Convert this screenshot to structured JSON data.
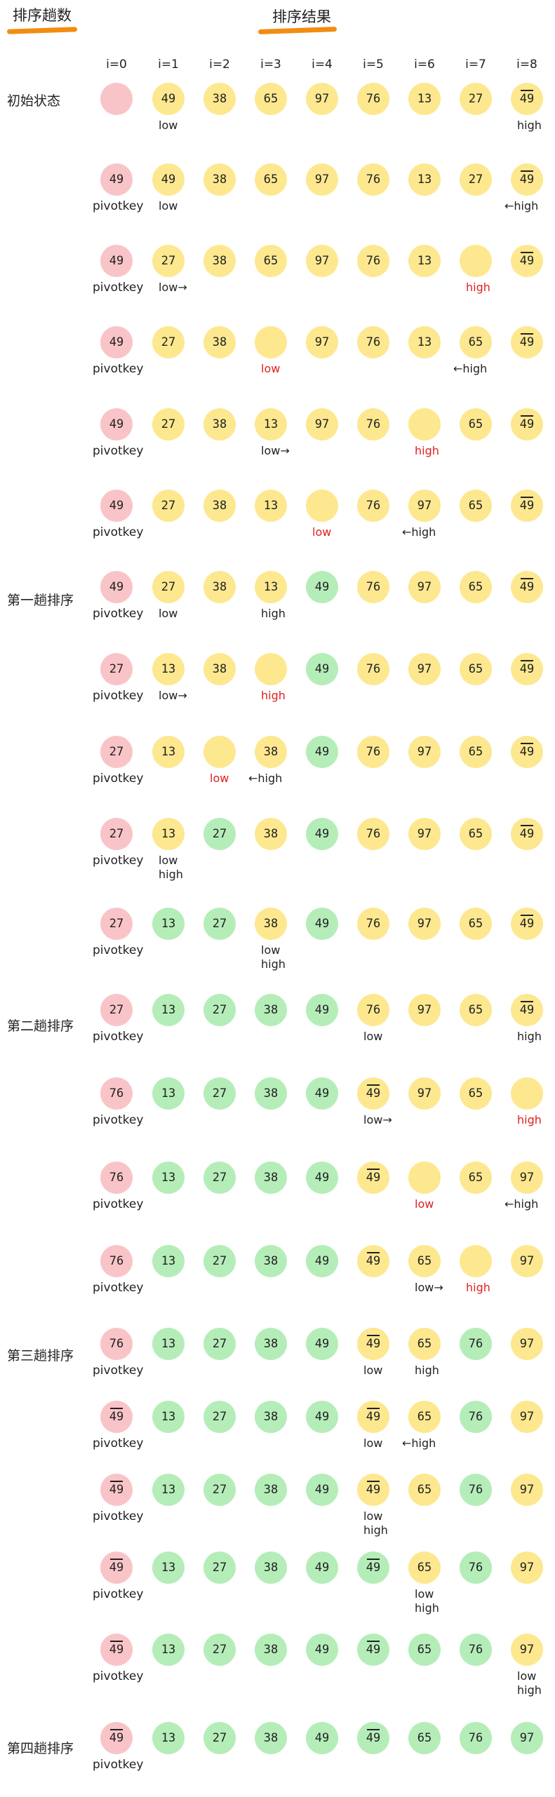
{
  "headers": {
    "left": "排序趟数",
    "right": "排序结果"
  },
  "columns": [
    "i=0",
    "i=1",
    "i=2",
    "i=3",
    "i=4",
    "i=5",
    "i=6",
    "i=7",
    "i=8"
  ],
  "pivot_label": "pivotkey",
  "rows": [
    {
      "label": "初始状态",
      "pivot": false,
      "cells": [
        [
          "",
          "pink"
        ],
        [
          "49",
          "yellow"
        ],
        [
          "38",
          "yellow"
        ],
        [
          "65",
          "yellow"
        ],
        [
          "97",
          "yellow"
        ],
        [
          "76",
          "yellow"
        ],
        [
          "13",
          "yellow"
        ],
        [
          "27",
          "yellow"
        ],
        [
          "49̄",
          "yellow"
        ]
      ],
      "marks": [
        {
          "col": 1,
          "text": "low"
        },
        {
          "col": 8,
          "text": "high"
        }
      ]
    },
    {
      "label": "",
      "pivot": true,
      "cells": [
        [
          "49",
          "pink"
        ],
        [
          "49",
          "yellow"
        ],
        [
          "38",
          "yellow"
        ],
        [
          "65",
          "yellow"
        ],
        [
          "97",
          "yellow"
        ],
        [
          "76",
          "yellow"
        ],
        [
          "13",
          "yellow"
        ],
        [
          "27",
          "yellow"
        ],
        [
          "49̄",
          "yellow"
        ]
      ],
      "marks": [
        {
          "col": 1,
          "text": "low"
        },
        {
          "col": 8,
          "text": "←high"
        }
      ]
    },
    {
      "label": "",
      "pivot": true,
      "cells": [
        [
          "49",
          "pink"
        ],
        [
          "27",
          "yellow"
        ],
        [
          "38",
          "yellow"
        ],
        [
          "65",
          "yellow"
        ],
        [
          "97",
          "yellow"
        ],
        [
          "76",
          "yellow"
        ],
        [
          "13",
          "yellow"
        ],
        [
          "",
          "yellow"
        ],
        [
          "49̄",
          "yellow"
        ]
      ],
      "marks": [
        {
          "col": 1,
          "text": "low→"
        },
        {
          "col": 7,
          "text": "high",
          "red": true
        }
      ]
    },
    {
      "label": "",
      "pivot": true,
      "cells": [
        [
          "49",
          "pink"
        ],
        [
          "27",
          "yellow"
        ],
        [
          "38",
          "yellow"
        ],
        [
          "",
          "yellow"
        ],
        [
          "97",
          "yellow"
        ],
        [
          "76",
          "yellow"
        ],
        [
          "13",
          "yellow"
        ],
        [
          "65",
          "yellow"
        ],
        [
          "49̄",
          "yellow"
        ]
      ],
      "marks": [
        {
          "col": 3,
          "text": "low",
          "red": true
        },
        {
          "col": 7,
          "text": "←high"
        }
      ]
    },
    {
      "label": "",
      "pivot": true,
      "cells": [
        [
          "49",
          "pink"
        ],
        [
          "27",
          "yellow"
        ],
        [
          "38",
          "yellow"
        ],
        [
          "13",
          "yellow"
        ],
        [
          "97",
          "yellow"
        ],
        [
          "76",
          "yellow"
        ],
        [
          "",
          "yellow"
        ],
        [
          "65",
          "yellow"
        ],
        [
          "49̄",
          "yellow"
        ]
      ],
      "marks": [
        {
          "col": 3,
          "text": "low→"
        },
        {
          "col": 6,
          "text": "high",
          "red": true
        }
      ]
    },
    {
      "label": "",
      "pivot": true,
      "cells": [
        [
          "49",
          "pink"
        ],
        [
          "27",
          "yellow"
        ],
        [
          "38",
          "yellow"
        ],
        [
          "13",
          "yellow"
        ],
        [
          "",
          "yellow"
        ],
        [
          "76",
          "yellow"
        ],
        [
          "97",
          "yellow"
        ],
        [
          "65",
          "yellow"
        ],
        [
          "49̄",
          "yellow"
        ]
      ],
      "marks": [
        {
          "col": 4,
          "text": "low",
          "red": true
        },
        {
          "col": 6,
          "text": "←high"
        }
      ]
    },
    {
      "label": "第一趟排序",
      "pivot": true,
      "cells": [
        [
          "49",
          "pink"
        ],
        [
          "27",
          "yellow"
        ],
        [
          "38",
          "yellow"
        ],
        [
          "13",
          "yellow"
        ],
        [
          "49",
          "green"
        ],
        [
          "76",
          "yellow"
        ],
        [
          "97",
          "yellow"
        ],
        [
          "65",
          "yellow"
        ],
        [
          "49̄",
          "yellow"
        ]
      ],
      "marks": [
        {
          "col": 1,
          "text": "low"
        },
        {
          "col": 3,
          "text": "high"
        }
      ]
    },
    {
      "label": "",
      "pivot": true,
      "cells": [
        [
          "27",
          "pink"
        ],
        [
          "13",
          "yellow"
        ],
        [
          "38",
          "yellow"
        ],
        [
          "",
          "yellow"
        ],
        [
          "49",
          "green"
        ],
        [
          "76",
          "yellow"
        ],
        [
          "97",
          "yellow"
        ],
        [
          "65",
          "yellow"
        ],
        [
          "49̄",
          "yellow"
        ]
      ],
      "marks": [
        {
          "col": 1,
          "text": "low→"
        },
        {
          "col": 3,
          "text": "high",
          "red": true
        }
      ]
    },
    {
      "label": "",
      "pivot": true,
      "cells": [
        [
          "27",
          "pink"
        ],
        [
          "13",
          "yellow"
        ],
        [
          "",
          "yellow"
        ],
        [
          "38",
          "yellow"
        ],
        [
          "49",
          "green"
        ],
        [
          "76",
          "yellow"
        ],
        [
          "97",
          "yellow"
        ],
        [
          "65",
          "yellow"
        ],
        [
          "49̄",
          "yellow"
        ]
      ],
      "marks": [
        {
          "col": 2,
          "text": "low",
          "red": true
        },
        {
          "col": 3,
          "text": "←high"
        }
      ]
    },
    {
      "label": "",
      "pivot": true,
      "cells": [
        [
          "27",
          "pink"
        ],
        [
          "13",
          "yellow"
        ],
        [
          "27",
          "green"
        ],
        [
          "38",
          "yellow"
        ],
        [
          "49",
          "green"
        ],
        [
          "76",
          "yellow"
        ],
        [
          "97",
          "yellow"
        ],
        [
          "65",
          "yellow"
        ],
        [
          "49̄",
          "yellow"
        ]
      ],
      "marks": [
        {
          "col": 1,
          "text": "low"
        },
        {
          "col": 1,
          "text": "high",
          "line2": true
        }
      ]
    },
    {
      "label": "",
      "pivot": true,
      "cells": [
        [
          "27",
          "pink"
        ],
        [
          "13",
          "green"
        ],
        [
          "27",
          "green"
        ],
        [
          "38",
          "yellow"
        ],
        [
          "49",
          "green"
        ],
        [
          "76",
          "yellow"
        ],
        [
          "97",
          "yellow"
        ],
        [
          "65",
          "yellow"
        ],
        [
          "49̄",
          "yellow"
        ]
      ],
      "marks": [
        {
          "col": 3,
          "text": "low"
        },
        {
          "col": 3,
          "text": "high",
          "line2": true
        }
      ]
    },
    {
      "label": "第二趟排序",
      "pivot": true,
      "cells": [
        [
          "27",
          "pink"
        ],
        [
          "13",
          "green"
        ],
        [
          "27",
          "green"
        ],
        [
          "38",
          "green"
        ],
        [
          "49",
          "green"
        ],
        [
          "76",
          "yellow"
        ],
        [
          "97",
          "yellow"
        ],
        [
          "65",
          "yellow"
        ],
        [
          "49̄",
          "yellow"
        ]
      ],
      "marks": [
        {
          "col": 5,
          "text": "low"
        },
        {
          "col": 8,
          "text": "high"
        }
      ]
    },
    {
      "label": "",
      "pivot": true,
      "cells": [
        [
          "76",
          "pink"
        ],
        [
          "13",
          "green"
        ],
        [
          "27",
          "green"
        ],
        [
          "38",
          "green"
        ],
        [
          "49",
          "green"
        ],
        [
          "49̄",
          "yellow"
        ],
        [
          "97",
          "yellow"
        ],
        [
          "65",
          "yellow"
        ],
        [
          "",
          "yellow"
        ]
      ],
      "marks": [
        {
          "col": 5,
          "text": "low→"
        },
        {
          "col": 8,
          "text": "high",
          "red": true
        }
      ]
    },
    {
      "label": "",
      "pivot": true,
      "cells": [
        [
          "76",
          "pink"
        ],
        [
          "13",
          "green"
        ],
        [
          "27",
          "green"
        ],
        [
          "38",
          "green"
        ],
        [
          "49",
          "green"
        ],
        [
          "49̄",
          "yellow"
        ],
        [
          "",
          "yellow"
        ],
        [
          "65",
          "yellow"
        ],
        [
          "97",
          "yellow"
        ]
      ],
      "marks": [
        {
          "col": 6,
          "text": "low",
          "red": true
        },
        {
          "col": 8,
          "text": "←high"
        }
      ]
    },
    {
      "label": "",
      "pivot": true,
      "cells": [
        [
          "76",
          "pink"
        ],
        [
          "13",
          "green"
        ],
        [
          "27",
          "green"
        ],
        [
          "38",
          "green"
        ],
        [
          "49",
          "green"
        ],
        [
          "49̄",
          "yellow"
        ],
        [
          "65",
          "yellow"
        ],
        [
          "",
          "yellow"
        ],
        [
          "97",
          "yellow"
        ]
      ],
      "marks": [
        {
          "col": 6,
          "text": "low→"
        },
        {
          "col": 7,
          "text": "high",
          "red": true
        }
      ]
    },
    {
      "label": "第三趟排序",
      "pivot": true,
      "cells": [
        [
          "76",
          "pink"
        ],
        [
          "13",
          "green"
        ],
        [
          "27",
          "green"
        ],
        [
          "38",
          "green"
        ],
        [
          "49",
          "green"
        ],
        [
          "49̄",
          "yellow"
        ],
        [
          "65",
          "yellow"
        ],
        [
          "76",
          "green"
        ],
        [
          "97",
          "yellow"
        ]
      ],
      "marks": [
        {
          "col": 5,
          "text": "low"
        },
        {
          "col": 6,
          "text": "high"
        }
      ]
    },
    {
      "label": "",
      "pivot": true,
      "cells": [
        [
          "49̄",
          "pink"
        ],
        [
          "13",
          "green"
        ],
        [
          "27",
          "green"
        ],
        [
          "38",
          "green"
        ],
        [
          "49",
          "green"
        ],
        [
          "49̄",
          "yellow"
        ],
        [
          "65",
          "yellow"
        ],
        [
          "76",
          "green"
        ],
        [
          "97",
          "yellow"
        ]
      ],
      "marks": [
        {
          "col": 5,
          "text": "low"
        },
        {
          "col": 6,
          "text": "←high"
        }
      ]
    },
    {
      "label": "",
      "pivot": true,
      "cells": [
        [
          "49̄",
          "pink"
        ],
        [
          "13",
          "green"
        ],
        [
          "27",
          "green"
        ],
        [
          "38",
          "green"
        ],
        [
          "49",
          "green"
        ],
        [
          "49̄",
          "yellow"
        ],
        [
          "65",
          "yellow"
        ],
        [
          "76",
          "green"
        ],
        [
          "97",
          "yellow"
        ]
      ],
      "marks": [
        {
          "col": 5,
          "text": "low"
        },
        {
          "col": 5,
          "text": "high",
          "line2": true
        }
      ]
    },
    {
      "label": "",
      "pivot": true,
      "cells": [
        [
          "49̄",
          "pink"
        ],
        [
          "13",
          "green"
        ],
        [
          "27",
          "green"
        ],
        [
          "38",
          "green"
        ],
        [
          "49",
          "green"
        ],
        [
          "49̄",
          "green"
        ],
        [
          "65",
          "yellow"
        ],
        [
          "76",
          "green"
        ],
        [
          "97",
          "yellow"
        ]
      ],
      "marks": [
        {
          "col": 6,
          "text": "low"
        },
        {
          "col": 6,
          "text": "high",
          "line2": true
        }
      ]
    },
    {
      "label": "",
      "pivot": true,
      "cells": [
        [
          "49̄",
          "pink"
        ],
        [
          "13",
          "green"
        ],
        [
          "27",
          "green"
        ],
        [
          "38",
          "green"
        ],
        [
          "49",
          "green"
        ],
        [
          "49̄",
          "green"
        ],
        [
          "65",
          "green"
        ],
        [
          "76",
          "green"
        ],
        [
          "97",
          "yellow"
        ]
      ],
      "marks": [
        {
          "col": 8,
          "text": "low"
        },
        {
          "col": 8,
          "text": "high",
          "line2": true
        }
      ]
    },
    {
      "label": "第四趟排序",
      "pivot": true,
      "cells": [
        [
          "49̄",
          "pink"
        ],
        [
          "13",
          "green"
        ],
        [
          "27",
          "green"
        ],
        [
          "38",
          "green"
        ],
        [
          "49",
          "green"
        ],
        [
          "49̄",
          "green"
        ],
        [
          "65",
          "green"
        ],
        [
          "76",
          "green"
        ],
        [
          "97",
          "green"
        ]
      ],
      "marks": []
    }
  ],
  "colors": {
    "yellow": "#fde88f",
    "green": "#b5edb9",
    "pink": "#f9c4c8",
    "red": "#e02020",
    "orange": "#f28c12"
  }
}
